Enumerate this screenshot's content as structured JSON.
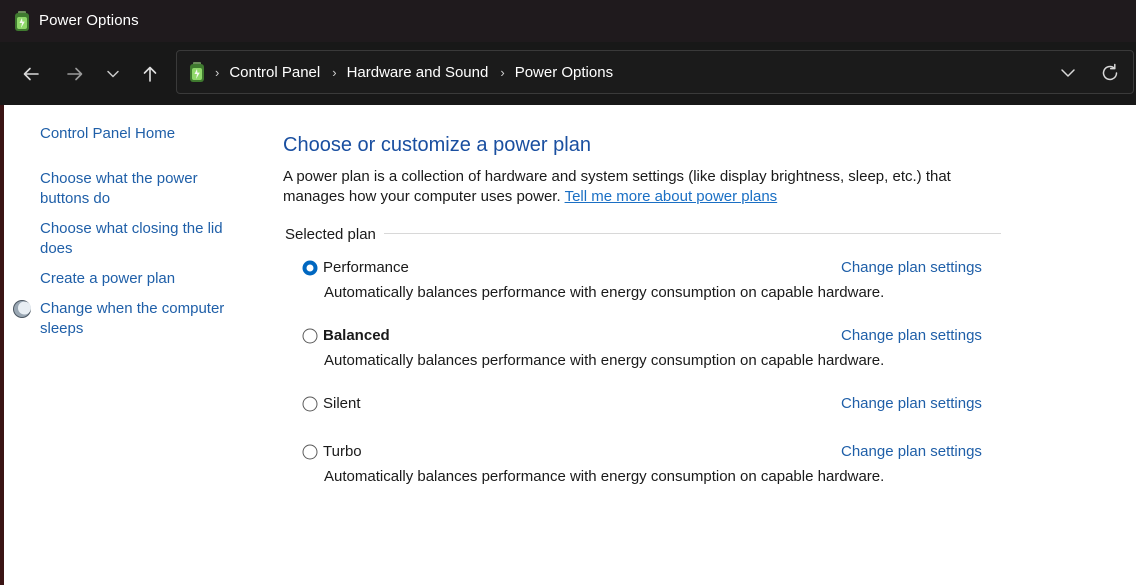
{
  "window": {
    "title": "Power Options",
    "icon": "battery-icon"
  },
  "nav": {
    "back_icon": "back-arrow-icon",
    "forward_icon": "forward-arrow-icon",
    "recent_icon": "chevron-down-icon",
    "up_icon": "up-arrow-icon"
  },
  "address": {
    "crumbs": [
      "Control Panel",
      "Hardware and Sound",
      "Power Options"
    ],
    "dropdown_icon": "chevron-down-icon",
    "refresh_icon": "refresh-icon"
  },
  "sidebar": {
    "items": [
      {
        "label": "Control Panel Home"
      },
      {
        "label": "Choose what the power buttons do"
      },
      {
        "label": "Choose what closing the lid does"
      },
      {
        "label": "Create a power plan"
      },
      {
        "label": "Change when the computer sleeps",
        "icon": "moon-icon"
      }
    ]
  },
  "main": {
    "heading": "Choose or customize a power plan",
    "description": "A power plan is a collection of hardware and system settings (like display brightness, sleep, etc.) that manages how your computer uses power.",
    "learn_more": "Tell me more about power plans",
    "group_label": "Selected plan",
    "plans": [
      {
        "name": "Performance",
        "selected": true,
        "link": "Change plan settings",
        "description": "Automatically balances performance with energy consumption on capable hardware."
      },
      {
        "name": "Balanced",
        "selected": false,
        "link": "Change plan settings",
        "description": "Automatically balances performance with energy consumption on capable hardware."
      },
      {
        "name": "Silent",
        "selected": false,
        "link": "Change plan settings",
        "description": ""
      },
      {
        "name": "Turbo",
        "selected": false,
        "link": "Change plan settings",
        "description": "Automatically balances performance with energy consumption on capable hardware."
      }
    ]
  },
  "colors": {
    "accent": "#1f5fa8",
    "heading": "#1a4fa0",
    "radio_selected": "#0067c0"
  }
}
